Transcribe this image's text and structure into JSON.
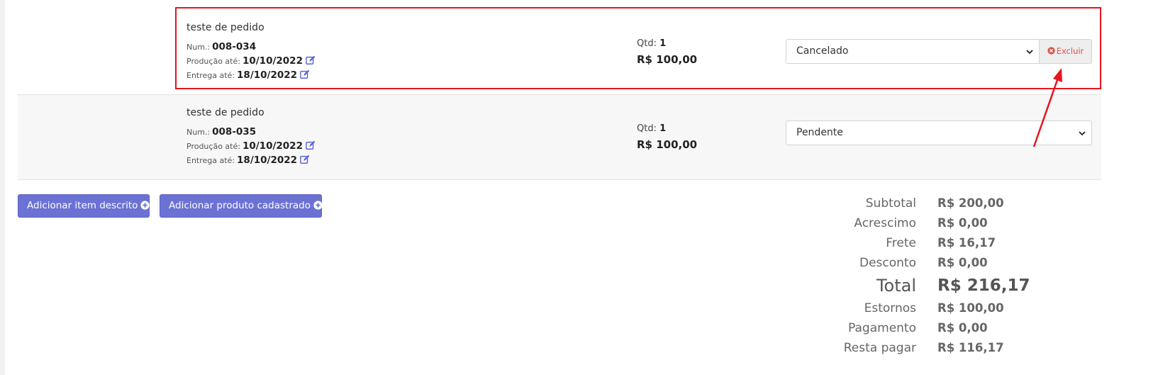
{
  "items": [
    {
      "title": "teste de pedido",
      "num_label": "Num.:",
      "num": "008-034",
      "producao_label": "Produção até:",
      "producao": "10/10/2022",
      "entrega_label": "Entrega até:",
      "entrega": "18/10/2022",
      "qtd_label": "Qtd:",
      "qtd": "1",
      "price": "R$ 100,00",
      "status": "Cancelado",
      "delete_label": "Excluir"
    },
    {
      "title": "teste de pedido",
      "num_label": "Num.:",
      "num": "008-035",
      "producao_label": "Produção até:",
      "producao": "10/10/2022",
      "entrega_label": "Entrega até:",
      "entrega": "18/10/2022",
      "qtd_label": "Qtd:",
      "qtd": "1",
      "price": "R$ 100,00",
      "status": "Pendente"
    }
  ],
  "buttons": {
    "add_described": "Adicionar item descrito",
    "add_registered": "Adicionar produto cadastrado"
  },
  "summary": [
    {
      "label": "Subtotal",
      "value": "R$ 200,00"
    },
    {
      "label": "Acrescimo",
      "value": "R$ 0,00"
    },
    {
      "label": "Frete",
      "value": "R$ 16,17"
    },
    {
      "label": "Desconto",
      "value": "R$ 0,00"
    },
    {
      "label": "Total",
      "value": "R$ 216,17"
    },
    {
      "label": "Estornos",
      "value": "R$ 100,00"
    },
    {
      "label": "Pagamento",
      "value": "R$ 0,00"
    },
    {
      "label": "Resta pagar",
      "value": "R$ 116,17"
    }
  ],
  "colors": {
    "accent": "#6b72d4",
    "danger": "#d9534f",
    "annotation": "#e8141c"
  },
  "icons": {
    "edit": "edit-icon",
    "delete": "times-circle-icon",
    "add": "plus-circle-icon",
    "select": "chevron-down-icon"
  }
}
